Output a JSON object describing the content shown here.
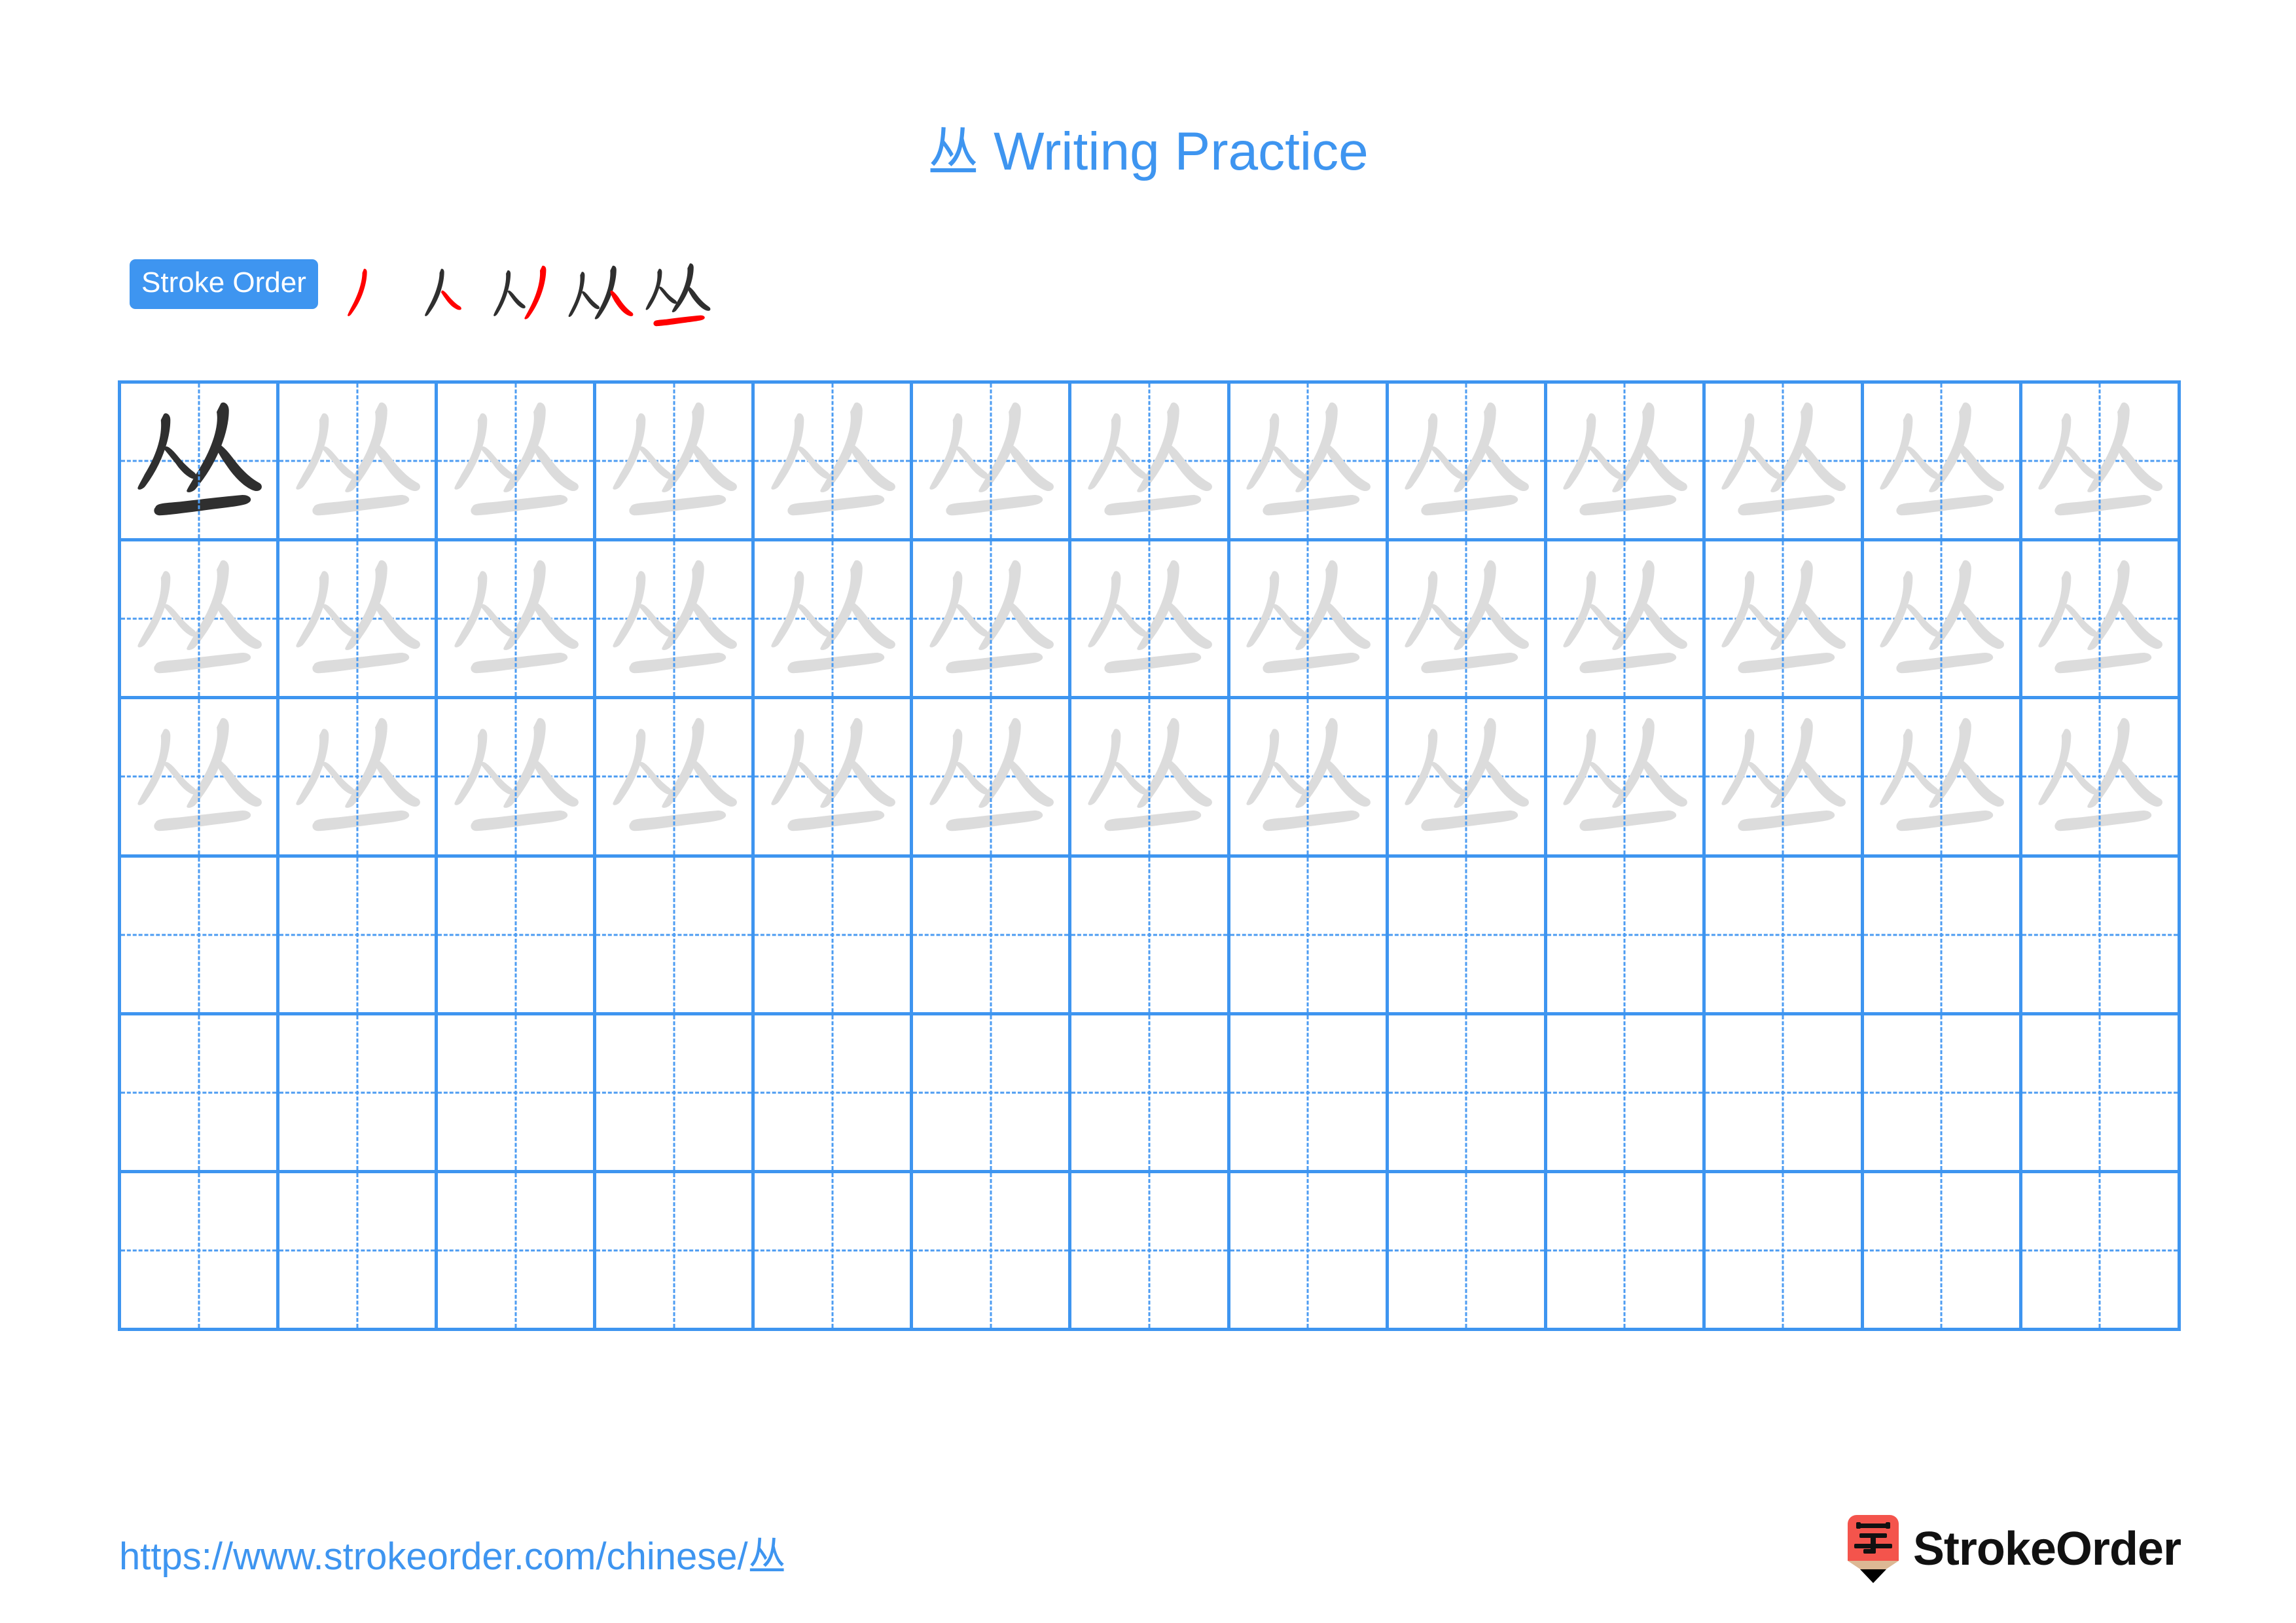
{
  "character": "丛",
  "title": {
    "character": "丛",
    "text": " Writing Practice",
    "full": "丛 Writing Practice",
    "color": "#3e95f0"
  },
  "stroke_order": {
    "label": "Stroke Order",
    "badge_color": "#3e95f0",
    "badge_text_color": "#ffffff",
    "new_stroke_color": "#ff0000",
    "existing_stroke_color": "#2f2f2f",
    "total_strokes": 5,
    "steps": [
      {
        "index": 1,
        "strokes_shown": 1,
        "new_stroke": "丿",
        "partial": "丿"
      },
      {
        "index": 2,
        "strokes_shown": 2,
        "new_stroke": "㇏",
        "partial": "人"
      },
      {
        "index": 3,
        "strokes_shown": 3,
        "new_stroke": "丿",
        "partial": "刈"
      },
      {
        "index": 4,
        "strokes_shown": 4,
        "new_stroke": "㇏",
        "partial": "从"
      },
      {
        "index": 5,
        "strokes_shown": 5,
        "new_stroke": "一",
        "partial": "丛"
      }
    ]
  },
  "grid": {
    "columns": 13,
    "rows": 6,
    "line_color": "#3e95f0",
    "guide_line_color": "#4d9cf2",
    "dark_glyph_color": "#2f2f2f",
    "trace_glyph_color": "#dcdcdc",
    "row_fill": [
      {
        "row": 1,
        "type": "model-then-trace",
        "filled_cells": 13,
        "dark_cells": 1
      },
      {
        "row": 2,
        "type": "trace",
        "filled_cells": 13,
        "dark_cells": 0
      },
      {
        "row": 3,
        "type": "trace",
        "filled_cells": 13,
        "dark_cells": 0
      },
      {
        "row": 4,
        "type": "blank",
        "filled_cells": 0,
        "dark_cells": 0
      },
      {
        "row": 5,
        "type": "blank",
        "filled_cells": 0,
        "dark_cells": 0
      },
      {
        "row": 6,
        "type": "blank",
        "filled_cells": 0,
        "dark_cells": 0
      }
    ]
  },
  "footer": {
    "url_prefix": "https://www.strokeorder.com/chinese/",
    "url_character": "丛",
    "url_full": "https://www.strokeorder.com/chinese/丛",
    "url_color": "#3e95f0",
    "brand_name": "StrokeOrder",
    "brand_icon_character": "字",
    "brand_icon_color": "#f4544c",
    "brand_icon_tip_color": "#dcb894",
    "brand_text_color": "#111111"
  }
}
